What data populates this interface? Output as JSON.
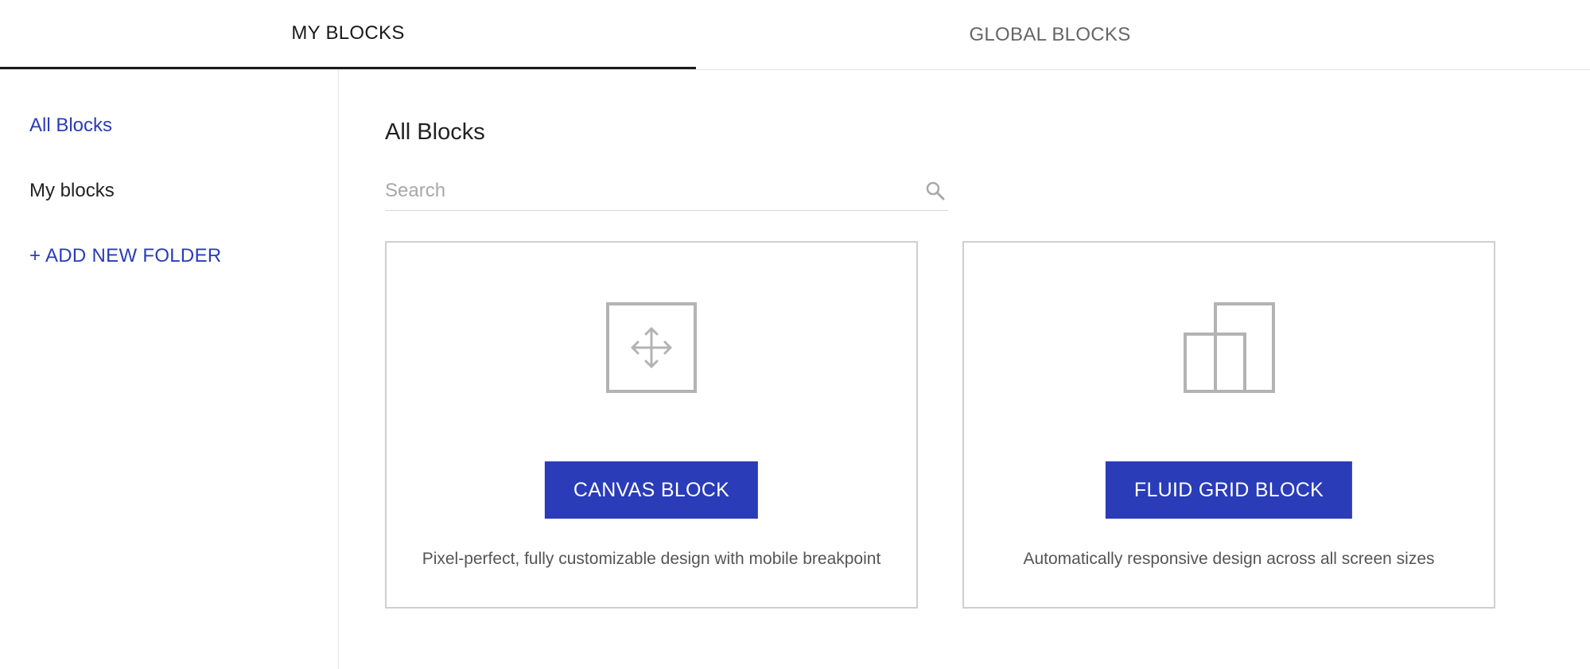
{
  "tabs": {
    "my_blocks": "MY BLOCKS",
    "global_blocks": "GLOBAL BLOCKS"
  },
  "sidebar": {
    "items": [
      {
        "label": "All Blocks",
        "active": true
      },
      {
        "label": "My blocks",
        "active": false
      }
    ],
    "add_folder": "+ ADD NEW FOLDER"
  },
  "main": {
    "title": "All Blocks",
    "search": {
      "placeholder": "Search",
      "value": ""
    },
    "cards": [
      {
        "button": "CANVAS BLOCK",
        "description": "Pixel-perfect, fully customizable design with mobile breakpoint",
        "icon": "move-arrows-icon"
      },
      {
        "button": "FLUID GRID BLOCK",
        "description": "Automatically responsive design across all screen sizes",
        "icon": "fluid-grid-icon"
      }
    ]
  },
  "colors": {
    "accent": "#2a3cb8",
    "icon_gray": "#b3b3b3",
    "border": "#cfcfcf"
  }
}
